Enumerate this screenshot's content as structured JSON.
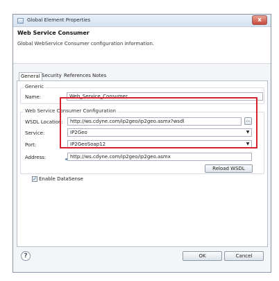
{
  "window": {
    "title": "Global Element Properties",
    "close_label": "x"
  },
  "header": {
    "title": "Web Service Consumer",
    "subtitle": "Global WebService Consumer configuration information."
  },
  "tabs": [
    {
      "label": "General"
    },
    {
      "label": "Security"
    },
    {
      "label": "References"
    },
    {
      "label": "Notes"
    }
  ],
  "generic": {
    "legend": "Generic",
    "name_label": "Name:",
    "name_value": "Web_Service_Consumer"
  },
  "config": {
    "legend": "Web Service Consumer Configuration",
    "wsdl_label": "WSDL Location:",
    "wsdl_value": "http://ws.cdyne.com/ip2geo/ip2geo.asmx?wsdl",
    "browse_label": "...",
    "service_label": "Service:",
    "service_value": "IP2Geo",
    "port_label": "Port:",
    "port_value": "IP2GeoSoap12",
    "address_label": "Address:",
    "address_value": "http://ws.cdyne.com/ip2geo/ip2geo.asmx",
    "reload_label": "Reload WSDL"
  },
  "datasense": {
    "label": "Enable DataSense",
    "checked": true
  },
  "footer": {
    "help_label": "?",
    "ok_label": "OK",
    "cancel_label": "Cancel"
  },
  "colors": {
    "highlight": "#d6202e"
  }
}
